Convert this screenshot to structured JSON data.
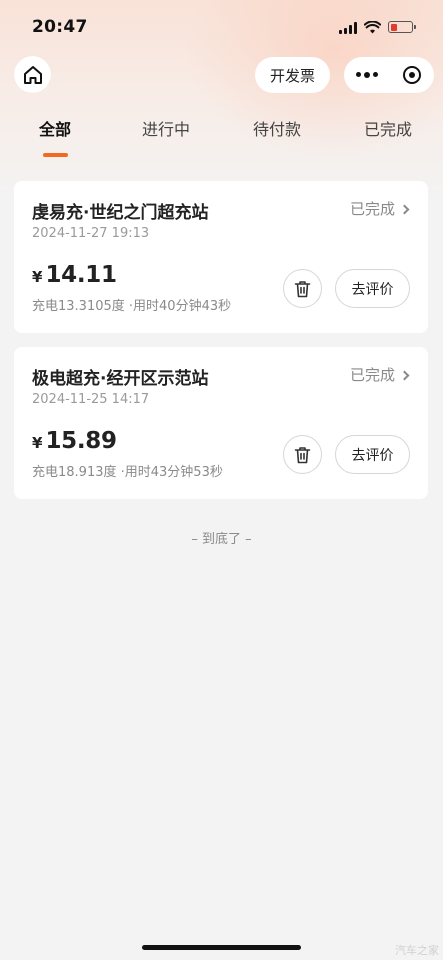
{
  "status_bar": {
    "time": "20:47"
  },
  "nav": {
    "invoice_label": "开发票"
  },
  "tabs": [
    {
      "label": "全部",
      "active": true
    },
    {
      "label": "进行中",
      "active": false
    },
    {
      "label": "待付款",
      "active": false
    },
    {
      "label": "已完成",
      "active": false
    }
  ],
  "orders": [
    {
      "title": "虔易充·世纪之门超充站",
      "status": "已完成",
      "time": "2024-11-27 19:13",
      "currency": "¥",
      "amount": "14.11",
      "detail": "充电13.3105度 ·用时40分钟43秒",
      "review_label": "去评价"
    },
    {
      "title": "极电超充·经开区示范站",
      "status": "已完成",
      "time": "2024-11-25 14:17",
      "currency": "¥",
      "amount": "15.89",
      "detail": "充电18.913度 ·用时43分钟53秒",
      "review_label": "去评价"
    }
  ],
  "bottom_tip": "– 到底了 –",
  "watermark": "汽车之家",
  "colors": {
    "accent": "#f06b1f",
    "background": "#f3f3f3"
  },
  "icons": [
    "home-icon",
    "more-icon",
    "close-capsule-icon",
    "chevron-right-icon",
    "trash-icon",
    "wifi-icon",
    "signal-icon",
    "battery-icon"
  ]
}
